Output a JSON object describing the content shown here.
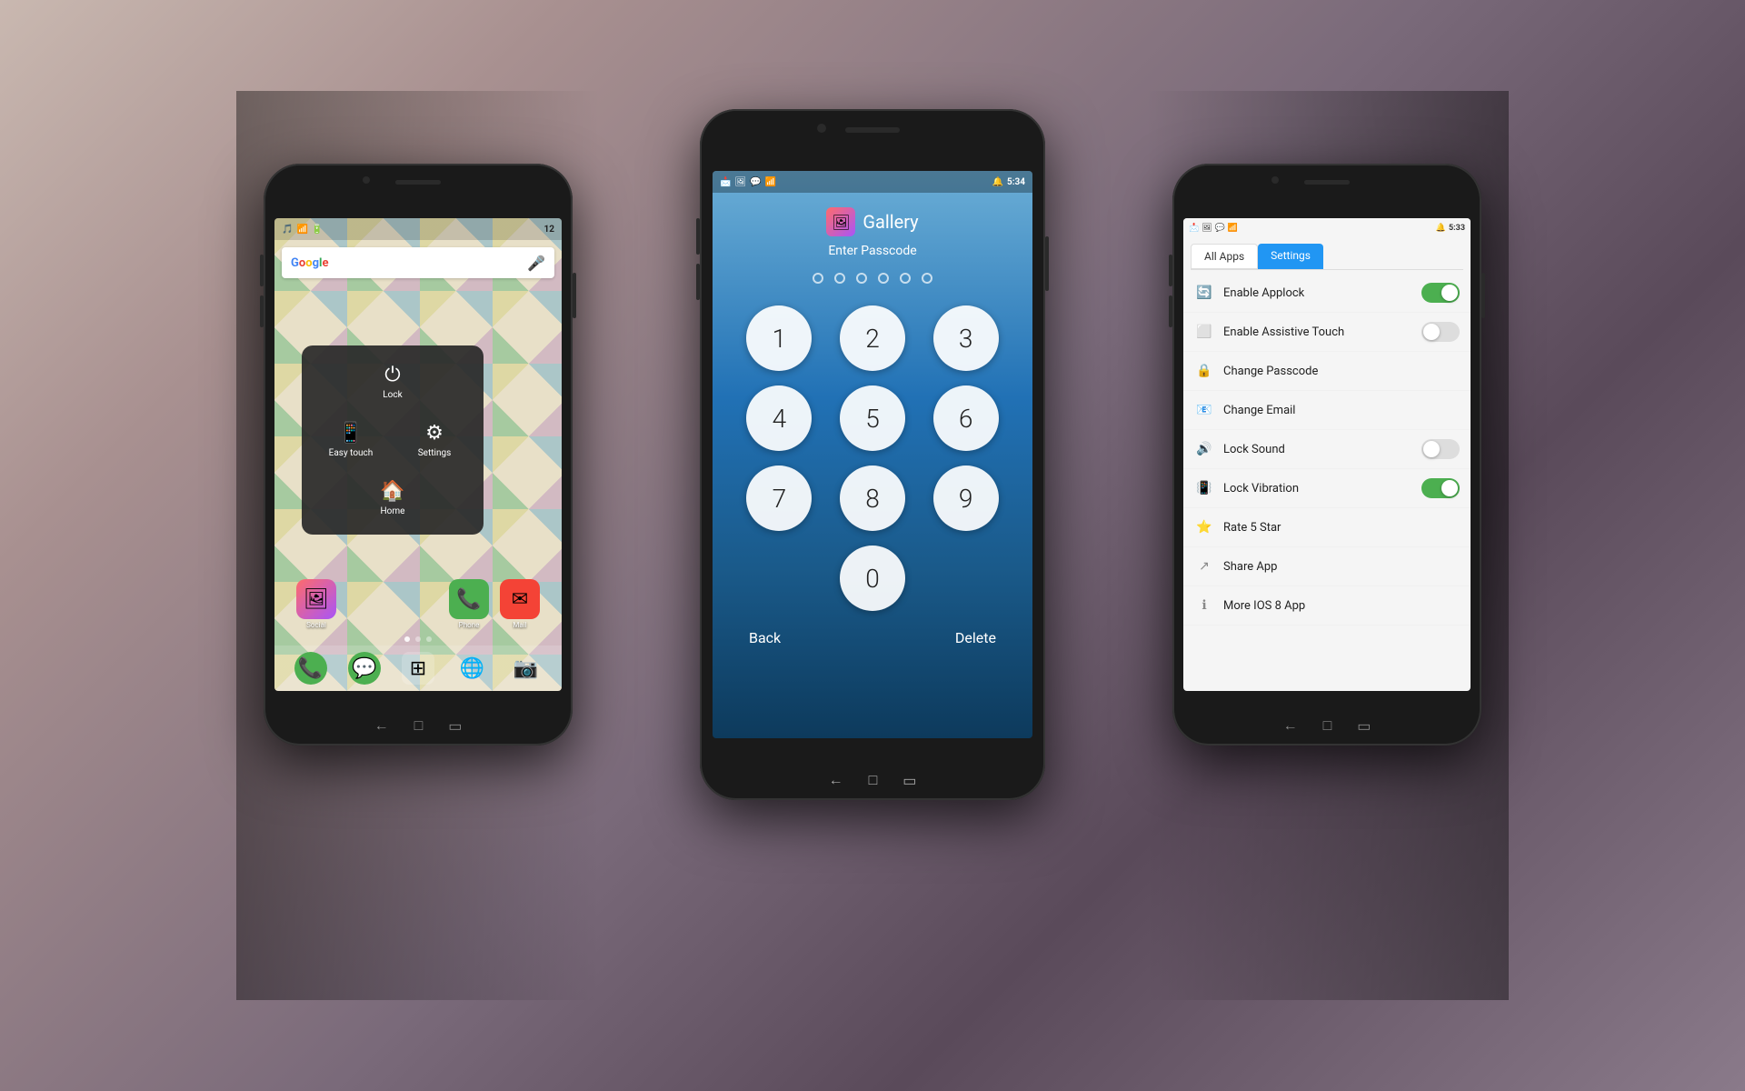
{
  "background": {
    "gradient": "dark brownish purple"
  },
  "left_phone": {
    "status_bar": {
      "left_icons": "🎵 📶 🔋",
      "time": "12",
      "signal": "▲▼"
    },
    "google_search": {
      "placeholder": "Google",
      "mic_icon": "🎤"
    },
    "quick_menu": {
      "items": [
        {
          "label": "Lock",
          "icon": "⏻"
        },
        {
          "label": "Easy touch",
          "icon": "📱"
        },
        {
          "label": "Home",
          "icon": "🏠"
        },
        {
          "label": "Settings",
          "icon": "⚙"
        }
      ]
    },
    "app_icons": [
      {
        "label": "Social",
        "icon": "🖼",
        "color": "#ff6b6b"
      },
      {
        "label": "Phone",
        "icon": "📞",
        "color": "#4caf50"
      },
      {
        "label": "Mail",
        "icon": "✉",
        "color": "#f44336"
      }
    ],
    "dock": [
      {
        "label": "Phone",
        "icon": "📞",
        "color": "#4caf50"
      },
      {
        "label": "Messages",
        "icon": "💬",
        "color": "#4caf50"
      },
      {
        "label": "Apps",
        "icon": "⊞",
        "color": "#888"
      },
      {
        "label": "Chrome",
        "icon": "◎",
        "color": "#4285f4"
      },
      {
        "label": "Camera",
        "icon": "📷",
        "color": "#ff9800"
      }
    ],
    "nav_buttons": [
      "←",
      "□",
      "▭"
    ]
  },
  "center_phone": {
    "status_bar": {
      "left_icons": "📩 🖼 💬 📶",
      "time": "5:34",
      "signal": "🔔 📶"
    },
    "app_name": "Gallery",
    "app_icon": "🖼",
    "prompt": "Enter Passcode",
    "dots_count": 6,
    "numpad": [
      "1",
      "2",
      "3",
      "4",
      "5",
      "6",
      "7",
      "8",
      "9",
      "0"
    ],
    "back_label": "Back",
    "delete_label": "Delete",
    "nav_buttons": [
      "←",
      "□",
      "▭"
    ]
  },
  "right_phone": {
    "status_bar": {
      "left_icons": "📩 🖼 💬 📶",
      "time": "5:33"
    },
    "tabs": [
      {
        "label": "All Apps",
        "active": false
      },
      {
        "label": "Settings",
        "active": true
      }
    ],
    "breadcrumb": "All Apps  Settings",
    "settings_items": [
      {
        "label": "Enable Applock",
        "icon": "🔄",
        "has_toggle": true,
        "toggle_on": true
      },
      {
        "label": "Enable Assistive Touch",
        "icon": "⬜",
        "has_toggle": true,
        "toggle_on": false
      },
      {
        "label": "Change Passcode",
        "icon": "🔒",
        "has_toggle": false
      },
      {
        "label": "Change Email",
        "icon": "📧",
        "has_toggle": false
      },
      {
        "label": "Lock Sound",
        "icon": "🔊",
        "has_toggle": true,
        "toggle_on": false
      },
      {
        "label": "Lock Vibration",
        "icon": "📳",
        "has_toggle": true,
        "toggle_on": true
      },
      {
        "label": "Rate 5 Star",
        "icon": "⭐",
        "has_toggle": false
      },
      {
        "label": "Share App",
        "icon": "↗",
        "has_toggle": false
      },
      {
        "label": "More IOS 8 App",
        "icon": "ℹ",
        "has_toggle": false
      }
    ],
    "nav_buttons": [
      "←",
      "□",
      "▭"
    ]
  }
}
